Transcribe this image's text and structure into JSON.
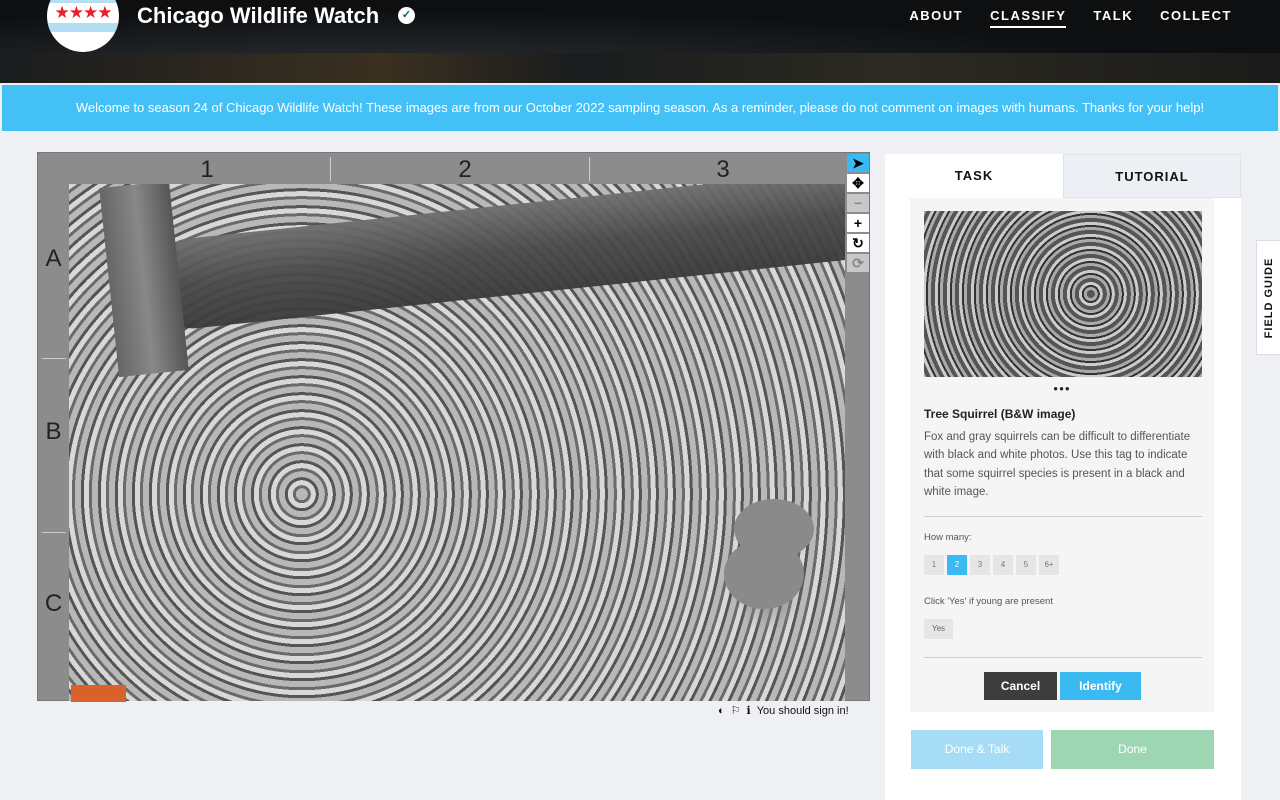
{
  "header": {
    "title": "Chicago Wildlife Watch",
    "logo_stars": "★★★★",
    "nav": [
      "ABOUT",
      "CLASSIFY",
      "TALK",
      "COLLECT"
    ],
    "active_nav": "CLASSIFY"
  },
  "banner": "Welcome to season 24 of Chicago Wildlife Watch! These images are from our October 2022 sampling season. As a reminder, please do not comment on images with humans. Thanks for your help!",
  "viewer": {
    "columns": [
      "1",
      "2",
      "3"
    ],
    "rows": [
      "A",
      "B",
      "C"
    ],
    "tools": {
      "pointer": "➤",
      "move": "✥",
      "zoom_out": "−",
      "zoom_in": "+",
      "rotate": "↻",
      "reset": "⟳"
    },
    "footer": {
      "invert": "◐",
      "flag": "⚐",
      "info": "ℹ",
      "sign_in": "You should sign in!"
    }
  },
  "panel": {
    "tabs": [
      "TASK",
      "TUTORIAL"
    ],
    "dots": "●●●",
    "species_title": "Tree Squirrel (B&W image)",
    "description": "Fox and gray squirrels can be difficult to differentiate with black and white photos. Use this tag to indicate that some squirrel species is present in a black and white image.",
    "how_many_label": "How many:",
    "counts": [
      "1",
      "2",
      "3",
      "4",
      "5",
      "6+"
    ],
    "selected_count": "2",
    "young_label": "Click 'Yes' if young are present",
    "yes": "Yes",
    "cancel": "Cancel",
    "identify": "Identify",
    "done_talk": "Done & Talk",
    "done": "Done"
  },
  "field_guide": "FIELD GUIDE",
  "colors": {
    "accent": "#3bbaf2",
    "banner": "#43c0f6",
    "done": "#9ed6b4",
    "done_talk": "#a6dcf5"
  }
}
